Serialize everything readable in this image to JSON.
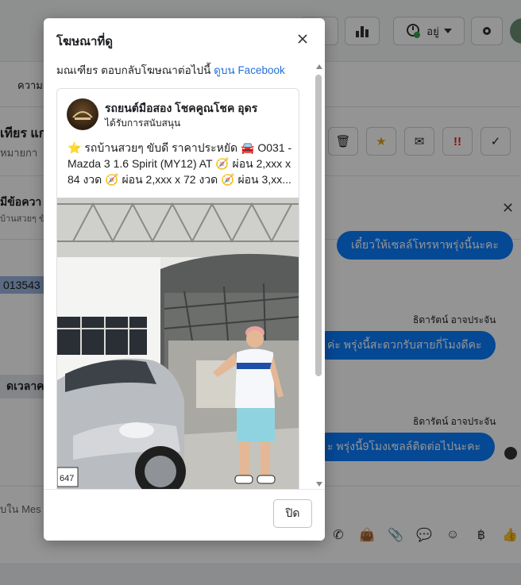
{
  "background": {
    "status_label": "อยู่",
    "tab_label": "ความเ",
    "contact_name": "เทียร แก",
    "contact_sub": "หมายกา",
    "info_title": "มีข้อควา",
    "info_sub": "บ้านสวยๆ ขับ",
    "highlight_id": "013543",
    "sender_1": "ธิดารัตน์ อาจประจัน",
    "sender_2": "ธิดารัตน์ อาจประจัน",
    "bubble_top": "เดี๋ยวให้เซลล์โทรหาพรุ่งนี้นะคะ",
    "bubble_1": "ค่ะ พรุ่งนี้สะดวกรับสายกี่โมงดีคะ",
    "bubble_2": "ะ พรุ่งนี้9โมงเซลล์ติดต่อไปนะคะ",
    "left_bubble": "ดเวลาคะ",
    "composer_placeholder": "บใน Mes"
  },
  "modal": {
    "title": "โฆษณาที่ดู",
    "description": "มณเฑียร ตอบกลับโฆษณาต่อไปนี้",
    "link_label": "ดูบน Facebook",
    "close_icon": "close-icon",
    "ad": {
      "page_name": "รถยนต์มือสอง โชคคูณโชค อุดร",
      "sponsored_label": "ได้รับการสนับสนุน",
      "body_text": "⭐ รถบ้านสวยๆ ขับดี ราคาประหยัด 🚘 O031 - Mazda 3 1.6 Spirit (MY12) AT 🧭 ผ่อน 2,xxx x 84 งวด 🧭 ผ่อน 2,xxx x 72 งวด 🧭 ผ่อน 3,xx...",
      "plate_text": "647"
    },
    "close_button_label": "ปิด"
  },
  "colors": {
    "accent": "#0a7cff",
    "link": "#216fdb"
  }
}
